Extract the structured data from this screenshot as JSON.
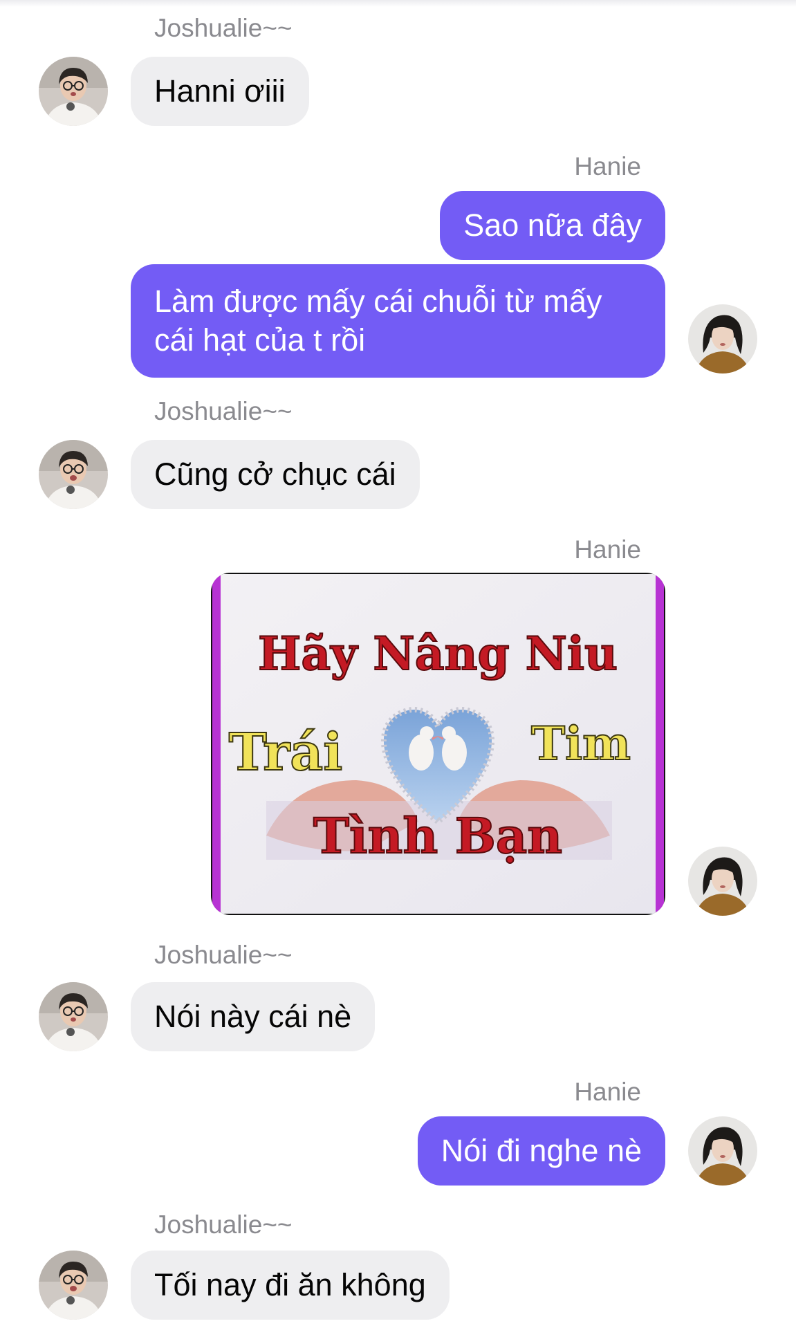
{
  "chat": {
    "colors": {
      "outgoing_bubble": "#735cf5",
      "incoming_bubble": "#eeeef0",
      "sender_label": "#8a8a8f"
    },
    "messages": [
      {
        "sender": "Joshualie~~",
        "direction": "incoming",
        "text": "Hanni ơiii"
      },
      {
        "sender": "Hanie",
        "direction": "outgoing",
        "text": "Sao nữa đây"
      },
      {
        "direction": "outgoing",
        "text": "Làm được mấy cái chuỗi từ mấy cái hạt của t rồi"
      },
      {
        "sender": "Joshualie~~",
        "direction": "incoming",
        "text": "Cũng cở chục cái"
      },
      {
        "sender": "Hanie",
        "direction": "outgoing",
        "type": "image",
        "image_text": {
          "line1": "Hãy Nâng Niu",
          "left": "Trái",
          "right": "Tim",
          "line3": "Tình Bạn"
        }
      },
      {
        "sender": "Joshualie~~",
        "direction": "incoming",
        "text": "Nói này cái nè"
      },
      {
        "sender": "Hanie",
        "direction": "outgoing",
        "text": "Nói đi nghe nè"
      },
      {
        "sender": "Joshualie~~",
        "direction": "incoming",
        "text": "Tối nay đi ăn không"
      }
    ]
  }
}
